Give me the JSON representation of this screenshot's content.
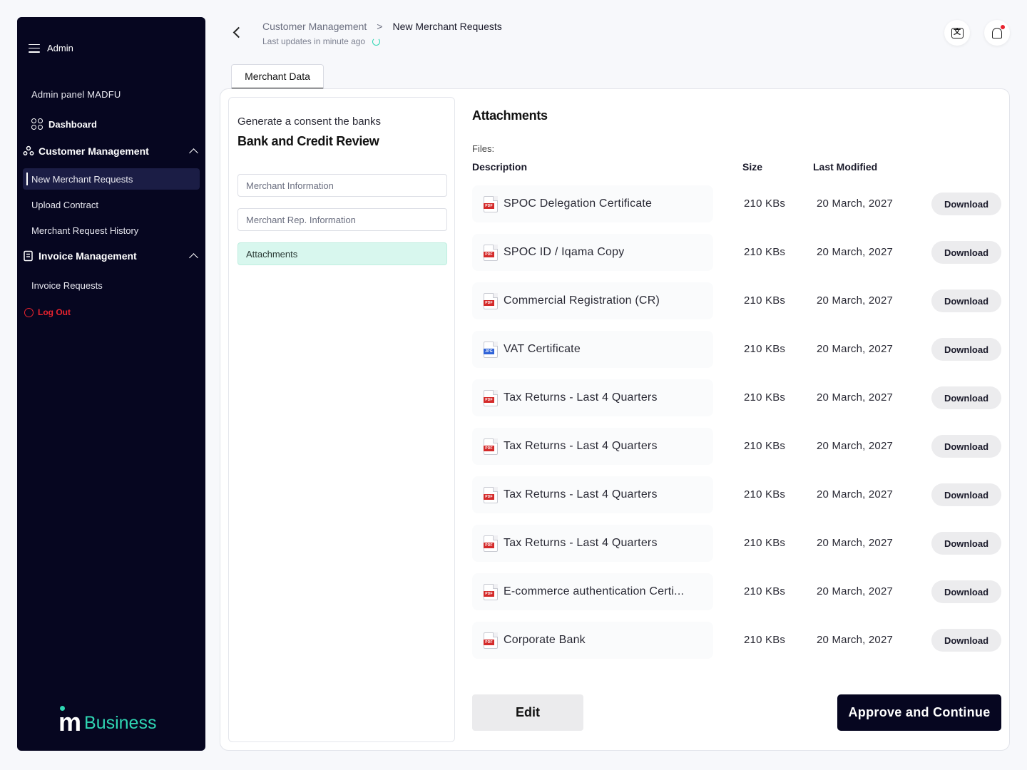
{
  "sidebar": {
    "role_label": "Admin",
    "panel_title": "Admin panel MADFU",
    "dashboard": "Dashboard",
    "customer_management": {
      "label": "Customer Management",
      "items": [
        "New Merchant Requests",
        "Upload Contract",
        "Merchant Request History"
      ]
    },
    "invoice_management": {
      "label": "Invoice Management",
      "items": [
        "Invoice Requests"
      ]
    },
    "logout": "Log Out",
    "brand_letter": "m",
    "brand_text": "Business"
  },
  "header": {
    "breadcrumb": [
      "Customer Management",
      "New Merchant Requests"
    ],
    "breadcrumb_sep": ">",
    "last_updated": "Last updates in minute ago",
    "translate_glyph": "文"
  },
  "tab": {
    "label": "Merchant Data"
  },
  "left_panel": {
    "subtitle": "Generate a consent the banks",
    "title": "Bank and Credit Review",
    "steps": [
      "Merchant Information",
      "Merchant Rep. Information",
      "Attachments"
    ],
    "active_step": "Attachments"
  },
  "attachments": {
    "title": "Attachments",
    "files_label": "Files:",
    "columns": {
      "description": "Description",
      "size": "Size",
      "last_modified": "Last Modified"
    },
    "download_label": "Download",
    "rows": [
      {
        "type": "PDF",
        "description": "SPOC Delegation Certificate",
        "size": "210 KBs",
        "modified": "20 March, 2027"
      },
      {
        "type": "PDF",
        "description": "SPOC ID / Iqama Copy",
        "size": "210 KBs",
        "modified": "20 March, 2027"
      },
      {
        "type": "PDF",
        "description": "Commercial Registration (CR)",
        "size": "210 KBs",
        "modified": "20 March, 2027"
      },
      {
        "type": "JPG",
        "description": "VAT Certificate",
        "size": "210 KBs",
        "modified": "20 March, 2027"
      },
      {
        "type": "PDF",
        "description": "Tax Returns - Last 4 Quarters",
        "size": "210 KBs",
        "modified": "20 March, 2027"
      },
      {
        "type": "PDF",
        "description": "Tax Returns - Last 4 Quarters",
        "size": "210 KBs",
        "modified": "20 March, 2027"
      },
      {
        "type": "PDF",
        "description": "Tax Returns - Last 4 Quarters",
        "size": "210 KBs",
        "modified": "20 March, 2027"
      },
      {
        "type": "PDF",
        "description": "Tax Returns - Last 4 Quarters",
        "size": "210 KBs",
        "modified": "20 March, 2027"
      },
      {
        "type": "PDF",
        "description": "E-commerce authentication Certi...",
        "size": "210 KBs",
        "modified": "20 March, 2027"
      },
      {
        "type": "PDF",
        "description": "Corporate Bank",
        "size": "210 KBs",
        "modified": "20 March, 2027"
      }
    ]
  },
  "actions": {
    "edit": "Edit",
    "approve": "Approve and Continue"
  },
  "colors": {
    "sidebar_bg": "#060620",
    "accent_teal": "#2fd6b3",
    "logout_red": "#e8232e",
    "active_step_bg": "#d8f7ee"
  }
}
